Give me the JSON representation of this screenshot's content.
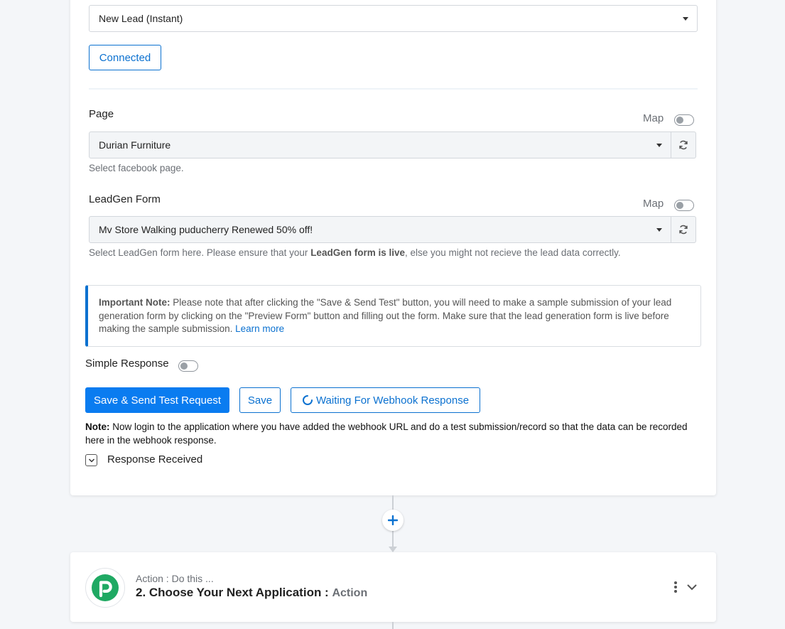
{
  "trigger": {
    "event_value": "New Lead (Instant)",
    "connected_label": "Connected"
  },
  "page_field": {
    "label": "Page",
    "map_label": "Map",
    "value": "Durian Furniture",
    "help": "Select facebook page."
  },
  "leadgen_field": {
    "label": "LeadGen Form",
    "map_label": "Map",
    "value": "Mv Store Walking puducherry Renewed 50% off!",
    "help_prefix": "Select LeadGen form here. Please ensure that your ",
    "help_bold": "LeadGen form is live",
    "help_suffix": ", else you might not recieve the lead data correctly."
  },
  "important_note": {
    "title": "Important Note:",
    "text": " Please note that after clicking the \"Save & Send Test\" button, you will need to make a sample submission of your lead generation form by clicking on the \"Preview Form\" button and filling out the form. Make sure that the lead generation form is live before making the sample submission. ",
    "link": "Learn more"
  },
  "simple_response": {
    "label": "Simple Response"
  },
  "buttons": {
    "save_send": "Save & Send Test Request",
    "save": "Save",
    "waiting": "Waiting For Webhook Response"
  },
  "note": {
    "title": "Note:",
    "text": " Now login to the application where you have added the webhook URL and do a test submission/record so that the data can be recorded here in the webhook response."
  },
  "response_received": {
    "label": "Response Received"
  },
  "next_step": {
    "subtitle": "Action : Do this ...",
    "title": "2. Choose Your Next Application : ",
    "title_muted": "Action"
  },
  "colors": {
    "accent": "#0b71d0",
    "primary_button": "#0a7cf0",
    "logo_green": "#1fa963"
  }
}
